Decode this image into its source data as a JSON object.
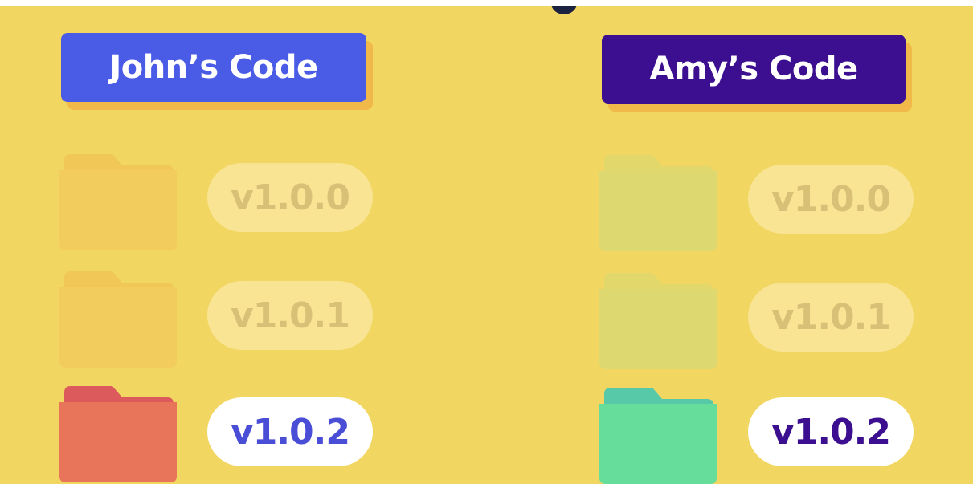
{
  "john": {
    "title": "John’s Code",
    "title_color": "#4a5be6",
    "folder_faded_color": "#f2c457",
    "folder_active_color": "#e8745a",
    "folder_active_tab_color": "#dc5a5c",
    "versions": [
      {
        "label": "v1.0.0",
        "state": "faded"
      },
      {
        "label": "v1.0.1",
        "state": "faded"
      },
      {
        "label": "v1.0.2",
        "state": "active"
      }
    ]
  },
  "amy": {
    "title": "Amy’s Code",
    "title_color": "#3b0f8f",
    "folder_faded_color": "#dfd86c",
    "folder_active_color": "#66dd9a",
    "folder_active_tab_color": "#58c9a8",
    "versions": [
      {
        "label": "v1.0.0",
        "state": "faded"
      },
      {
        "label": "v1.0.1",
        "state": "faded"
      },
      {
        "label": "v1.0.2",
        "state": "active"
      }
    ]
  },
  "colors": {
    "background": "#f2d662",
    "title_shadow": "#f0b94a"
  }
}
